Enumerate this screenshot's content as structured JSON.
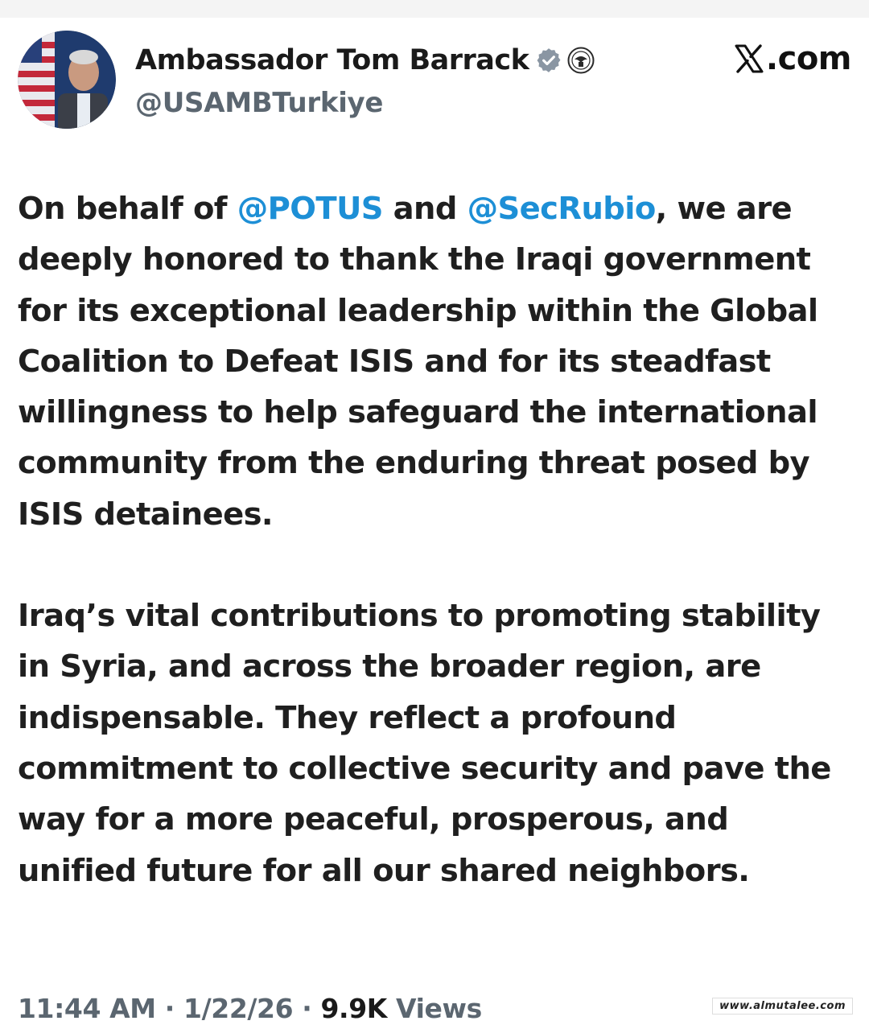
{
  "header": {
    "display_name": "Ambassador Tom Barrack",
    "handle": "@USAMBTurkiye",
    "site_label": ".com",
    "verified_icon": "verified-badge-icon",
    "affiliation_icon": "state-department-seal-icon"
  },
  "tweet": {
    "p1": {
      "t1": "On behalf of ",
      "m1": "@POTUS",
      "t2": " and ",
      "m2": "@SecRubio",
      "t3": ", we are deeply honored to thank the Iraqi government for its exceptional leadership within the Global Coalition to Defeat ISIS and for its steadfast willingness to help safeguard the international community from the enduring threat posed by ISIS detainees."
    },
    "p2": "Iraq’s vital contributions to promoting stability in Syria, and across the broader region, are indispensable. They reflect a profound commitment to collective security and pave the way for a more peaceful, prosperous, and unified future for all our shared neighbors."
  },
  "meta": {
    "time": "11:44 AM",
    "sep1": " · ",
    "date": "1/22/26",
    "sep2": " · ",
    "views_count": "9.9K",
    "views_label": " Views"
  },
  "watermark": "www.almutalee.com",
  "colors": {
    "mention": "#1d8fd6",
    "secondary_text": "#5b6670",
    "verified_badge": "#8a96a3"
  }
}
